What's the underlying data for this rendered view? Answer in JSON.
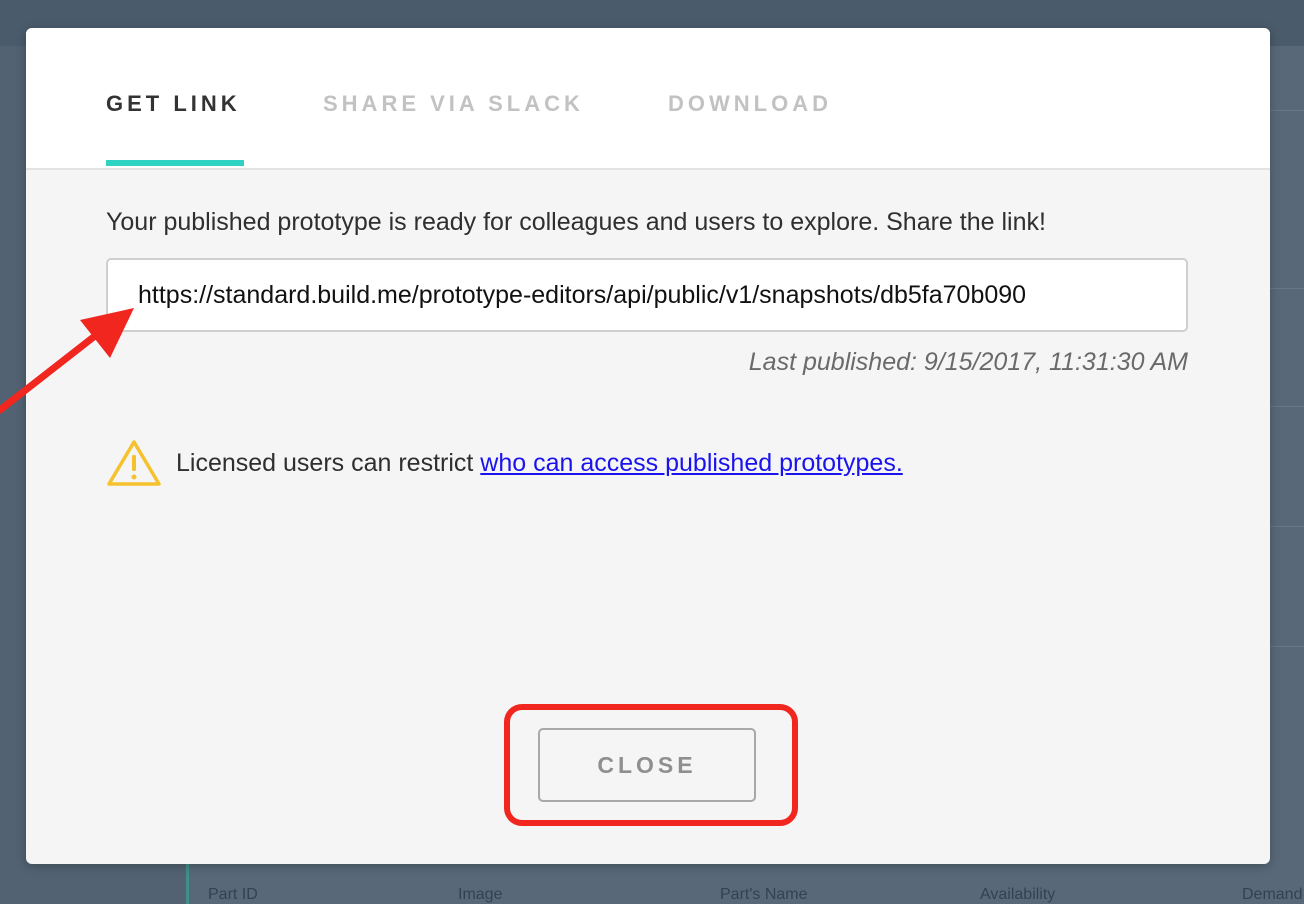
{
  "modal": {
    "tabs": [
      {
        "label": "GET LINK",
        "active": true
      },
      {
        "label": "SHARE VIA SLACK",
        "active": false
      },
      {
        "label": "DOWNLOAD",
        "active": false
      }
    ],
    "intro_text": "Your published prototype is ready for colleagues and users to explore. Share the link!",
    "share_url": "https://standard.build.me/prototype-editors/api/public/v1/snapshots/db5fa70b090",
    "last_published": "Last published: 9/15/2017, 11:31:30 AM",
    "warning": {
      "icon": "warning-triangle-icon",
      "text": "Licensed users can restrict ",
      "link_text": "who can access published prototypes."
    },
    "close_label": "CLOSE"
  },
  "background_table": {
    "headers": [
      "Part ID",
      "Image",
      "Part's Name",
      "Availability",
      "Demand"
    ]
  },
  "colors": {
    "accent": "#2fd3c3",
    "link": "#1a13ee",
    "warning": "#f5c22e",
    "annotation": "#f0261f"
  }
}
